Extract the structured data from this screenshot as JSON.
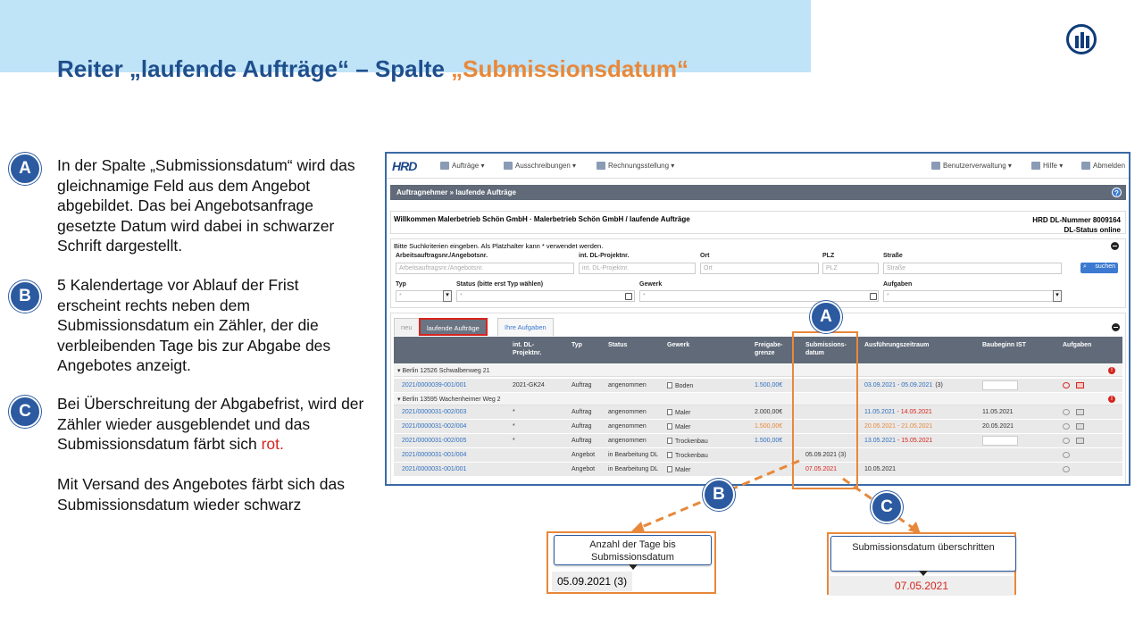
{
  "slide": {
    "title_part1": "Reiter „laufende Aufträge“ – Spalte ",
    "title_part2": "„Submissionsdatum“",
    "colors": {
      "accent_orange": "#e8883a",
      "brand_blue": "#2b5aa0",
      "title_blue": "#1f4e8c",
      "alert_red": "#d6241e",
      "band": "#bfe3f7"
    },
    "logo_icon": "allianz-logo-icon"
  },
  "points": [
    {
      "badge": "A",
      "text": "In der Spalte „Submissionsdatum“ wird das gleichnamige Feld aus dem Angebot abgebildet. Das bei Angebotsanfrage gesetzte Datum wird dabei in schwarzer Schrift dargestellt."
    },
    {
      "badge": "B",
      "text": "5 Kalendertage vor  Ablauf der Frist erscheint rechts neben dem Submissionsdatum ein Zähler, der die verbleibenden Tage bis zur Abgabe des Angebotes anzeigt."
    },
    {
      "badge": "C",
      "text_before": "Bei Überschreitung der Abgabefrist, wird der Zähler wieder ausgeblendet und das Submissionsdatum färbt sich ",
      "text_red": "rot.",
      "text_after": "Mit Versand des Angebotes färbt sich das Submissionsdatum wieder schwarz"
    }
  ],
  "app": {
    "brand": "HRD",
    "menu": [
      {
        "label": "Aufträge ▾",
        "icon": "orders-icon"
      },
      {
        "label": "Ausschreibungen ▾",
        "icon": "tender-icon"
      },
      {
        "label": "Rechnungsstellung ▾",
        "icon": "invoice-icon"
      }
    ],
    "menu_right": [
      {
        "label": "Benutzerverwaltung ▾",
        "icon": "users-icon"
      },
      {
        "label": "Hilfe ▾",
        "icon": "help-icon"
      },
      {
        "label": "Abmelden",
        "icon": "logout-icon"
      }
    ],
    "breadcrumb": "Auftragnehmer » laufende Aufträge",
    "help_symbol": "?",
    "welcome": "Willkommen Malerbetrieb Schön GmbH · Malerbetrieb Schön GmbH / laufende Aufträge",
    "hrd_number": "HRD DL-Nummer 8009164",
    "dl_status": "DL-Status online",
    "search": {
      "hint": "Bitte Suchkriterien eingeben. Als Platzhalter kann * verwendet werden.",
      "labels": {
        "auftrag": "Arbeitsauftragsnr./Angebotsnr.",
        "projekt": "int. DL-Projektnr.",
        "ort": "Ort",
        "plz": "PLZ",
        "strasse": "Straße",
        "typ": "Typ",
        "status": "Status (bitte erst Typ wählen)",
        "gewerk": "Gewerk",
        "aufgaben": "Aufgaben"
      },
      "placeholders": {
        "auftrag": "Arbeitsauftragsnr./Angebotsnr.",
        "projekt": "int. DL-Projektnr.",
        "ort": "Ort",
        "plz": "PLZ",
        "strasse": "Straße",
        "typ": "*",
        "status": "*",
        "gewerk": "*",
        "aufgaben": "*"
      },
      "button": "suchen",
      "select_arrow": "▾"
    },
    "tabs": [
      "neu",
      "laufende Aufträge",
      "Ihre Aufgaben"
    ],
    "columns": [
      "int. DL-Projektnr.",
      "Typ",
      "Status",
      "Gewerk",
      "Freigabe-grenze",
      "Submissions-datum",
      "Ausführungszeitraum",
      "Baubeginn IST",
      "Aufgaben"
    ],
    "groups": [
      {
        "label": "▾ Berlin 12526 Schwalbenweg 21",
        "rows": [
          {
            "nr": "2021/0000039-001/001",
            "projekt": "2021-GK24",
            "typ": "Auftrag",
            "status": "angenommen",
            "gewerk": "Boden",
            "freigabe": "1.500,00€",
            "freigabe_style": "link",
            "sub": "",
            "az_start": "03.09.2021",
            "az_sep": " - ",
            "az_end": "05.09.2021",
            "az_suffix": "(3)",
            "az_style": "link",
            "baubeginn": "",
            "has_input": true,
            "task_alert": true
          }
        ]
      },
      {
        "label": "▾ Berlin 13595 Wachenheimer Weg 2",
        "rows": [
          {
            "nr": "2021/0000031-002/003",
            "projekt": "*",
            "typ": "Auftrag",
            "status": "angenommen",
            "gewerk": "Maler",
            "freigabe": "2.000,00€",
            "freigabe_style": "plain",
            "sub": "",
            "az_start": "11.05.2021",
            "az_sep": " - ",
            "az_end": "14.05.2021",
            "az_suffix": "",
            "az_style": "mixed",
            "baubeginn": "11.05.2021",
            "has_input": false,
            "task_alert": false
          },
          {
            "nr": "2021/0000031-002/004",
            "projekt": "*",
            "typ": "Auftrag",
            "status": "angenommen",
            "gewerk": "Maler",
            "freigabe": "1.500,00€",
            "freigabe_style": "orange",
            "sub": "",
            "az_start": "20.05.2021",
            "az_sep": " - ",
            "az_end": "21.05.2021",
            "az_suffix": "",
            "az_style": "orange",
            "baubeginn": "20.05.2021",
            "has_input": false,
            "task_alert": false
          },
          {
            "nr": "2021/0000031-002/005",
            "projekt": "*",
            "typ": "Auftrag",
            "status": "angenommen",
            "gewerk": "Trockenbau",
            "freigabe": "1.500,00€",
            "freigabe_style": "link",
            "sub": "",
            "az_start": "13.05.2021",
            "az_sep": " - ",
            "az_end": "15.05.2021",
            "az_suffix": "",
            "az_style": "mixed",
            "baubeginn": "",
            "has_input": true,
            "task_alert": false
          },
          {
            "nr": "2021/0000031-001/004",
            "projekt": "",
            "typ": "Angebot",
            "status": "in Bearbeitung DL",
            "gewerk": "Trockenbau",
            "freigabe": "",
            "freigabe_style": "plain",
            "sub": "05.09.2021 (3)",
            "sub_style": "plain",
            "az_start": "",
            "az_sep": "",
            "az_end": "",
            "az_suffix": "",
            "az_style": "plain",
            "baubeginn": "",
            "has_input": false,
            "task_alert": false,
            "chat_only": true
          },
          {
            "nr": "2021/0000031-001/001",
            "projekt": "",
            "typ": "Angebot",
            "status": "in Bearbeitung DL",
            "gewerk": "Maler",
            "freigabe": "",
            "freigabe_style": "plain",
            "sub": "07.05.2021",
            "sub_style": "red",
            "az_start": "10.05.2021",
            "az_sep": "",
            "az_end": "",
            "az_suffix": "",
            "az_style": "plain",
            "baubeginn": "",
            "has_input": false,
            "task_alert": false,
            "chat_only": true
          }
        ]
      }
    ]
  },
  "callouts": {
    "b_badge": "B",
    "c_badge": "C",
    "a_badge": "A",
    "b_tooltip": "Anzahl der Tage bis Submissionsdatum",
    "b_value": "05.09.2021 (3)",
    "c_tooltip": "Submissionsdatum überschritten",
    "c_value": "07.05.2021"
  }
}
